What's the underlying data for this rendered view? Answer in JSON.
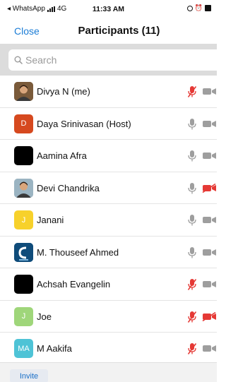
{
  "status_bar": {
    "carrier": "◂ WhatsApp",
    "network": "4G",
    "time": "11:33 AM"
  },
  "nav": {
    "close_label": "Close",
    "title": "Participants (11)"
  },
  "search": {
    "placeholder": "Search"
  },
  "colors": {
    "accent": "#1a7cd6",
    "muted_red": "#e53935",
    "icon_gray": "#9e9e9e"
  },
  "participants": [
    {
      "name": "Divya N (me)",
      "avatar": "photo-person",
      "initial": "",
      "avatar_color": "#7a5a3a",
      "mic": "muted",
      "cam": "off"
    },
    {
      "name": "Daya Srinivasan (Host)",
      "avatar": "initial",
      "initial": "D",
      "avatar_color": "#d6491f",
      "mic": "on",
      "cam": "off"
    },
    {
      "name": "Aamina Afra",
      "avatar": "black",
      "initial": "",
      "avatar_color": "#000000",
      "mic": "on",
      "cam": "off"
    },
    {
      "name": "Devi Chandrika",
      "avatar": "photo-person",
      "initial": "",
      "avatar_color": "#9bb4c2",
      "mic": "on",
      "cam": "muted"
    },
    {
      "name": "Janani",
      "avatar": "initial",
      "initial": "J",
      "avatar_color": "#f7d12b",
      "mic": "on",
      "cam": "off"
    },
    {
      "name": "M. Thouseef Ahmed",
      "avatar": "logo",
      "initial": "",
      "avatar_color": "#0f4c7a",
      "mic": "on",
      "cam": "off"
    },
    {
      "name": "Achsah Evangelin",
      "avatar": "black",
      "initial": "",
      "avatar_color": "#000000",
      "mic": "muted",
      "cam": "off"
    },
    {
      "name": "Joe",
      "avatar": "initial",
      "initial": "J",
      "avatar_color": "#9fd67a",
      "mic": "muted",
      "cam": "muted"
    },
    {
      "name": "M Aakifa",
      "avatar": "initial",
      "initial": "MA",
      "avatar_color": "#4ec3d6",
      "mic": "muted",
      "cam": "off"
    }
  ],
  "footer": {
    "invite_label": "Invite"
  }
}
